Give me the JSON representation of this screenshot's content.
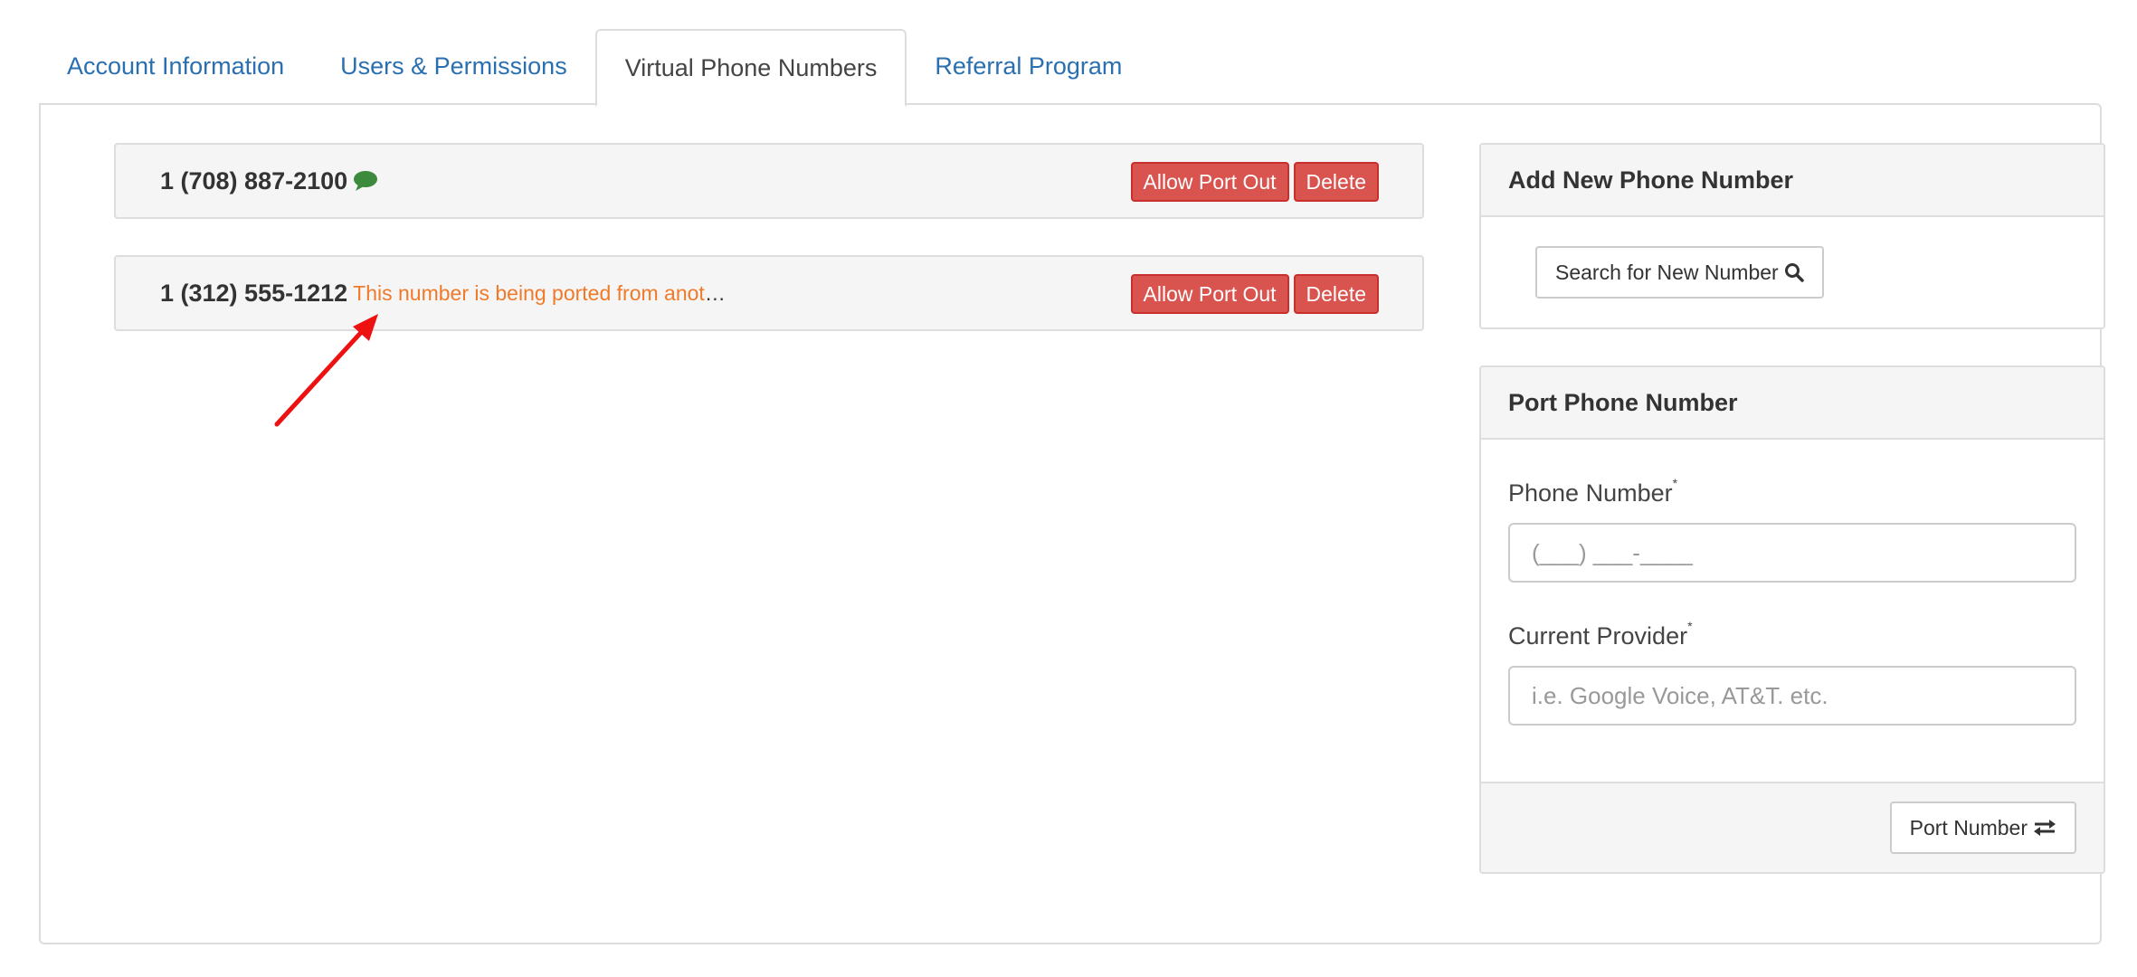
{
  "tabs": [
    {
      "label": "Account Information",
      "active": false
    },
    {
      "label": "Users & Permissions",
      "active": false
    },
    {
      "label": "Virtual Phone Numbers",
      "active": true
    },
    {
      "label": "Referral Program",
      "active": false
    }
  ],
  "numbers": [
    {
      "number": "1 (708) 887-2100",
      "note": "",
      "has_chat_icon": true,
      "allow_port_out_label": "Allow Port Out",
      "delete_label": "Delete"
    },
    {
      "number": "1 (312) 555-1212",
      "note": "This number is being ported from anot",
      "note_ellipsis": "…",
      "has_chat_icon": false,
      "allow_port_out_label": "Allow Port Out",
      "delete_label": "Delete"
    }
  ],
  "add_panel": {
    "title": "Add New Phone Number",
    "search_button_label": "Search for New Number",
    "search_icon": "search-icon"
  },
  "port_panel": {
    "title": "Port Phone Number",
    "phone_label": "Phone Number",
    "phone_required_mark": "*",
    "phone_placeholder": "(___) ___-____",
    "provider_label": "Current Provider",
    "provider_required_mark": "*",
    "provider_placeholder": "i.e. Google Voice, AT&T. etc.",
    "submit_label": "Port Number",
    "submit_icon": "exchange-arrows-icon"
  },
  "colors": {
    "link": "#2a6fb0",
    "danger": "#d9534f",
    "warning_text": "#f07a2a",
    "chat_icon": "#3c8a3c",
    "annotation_arrow": "#ee1111"
  }
}
